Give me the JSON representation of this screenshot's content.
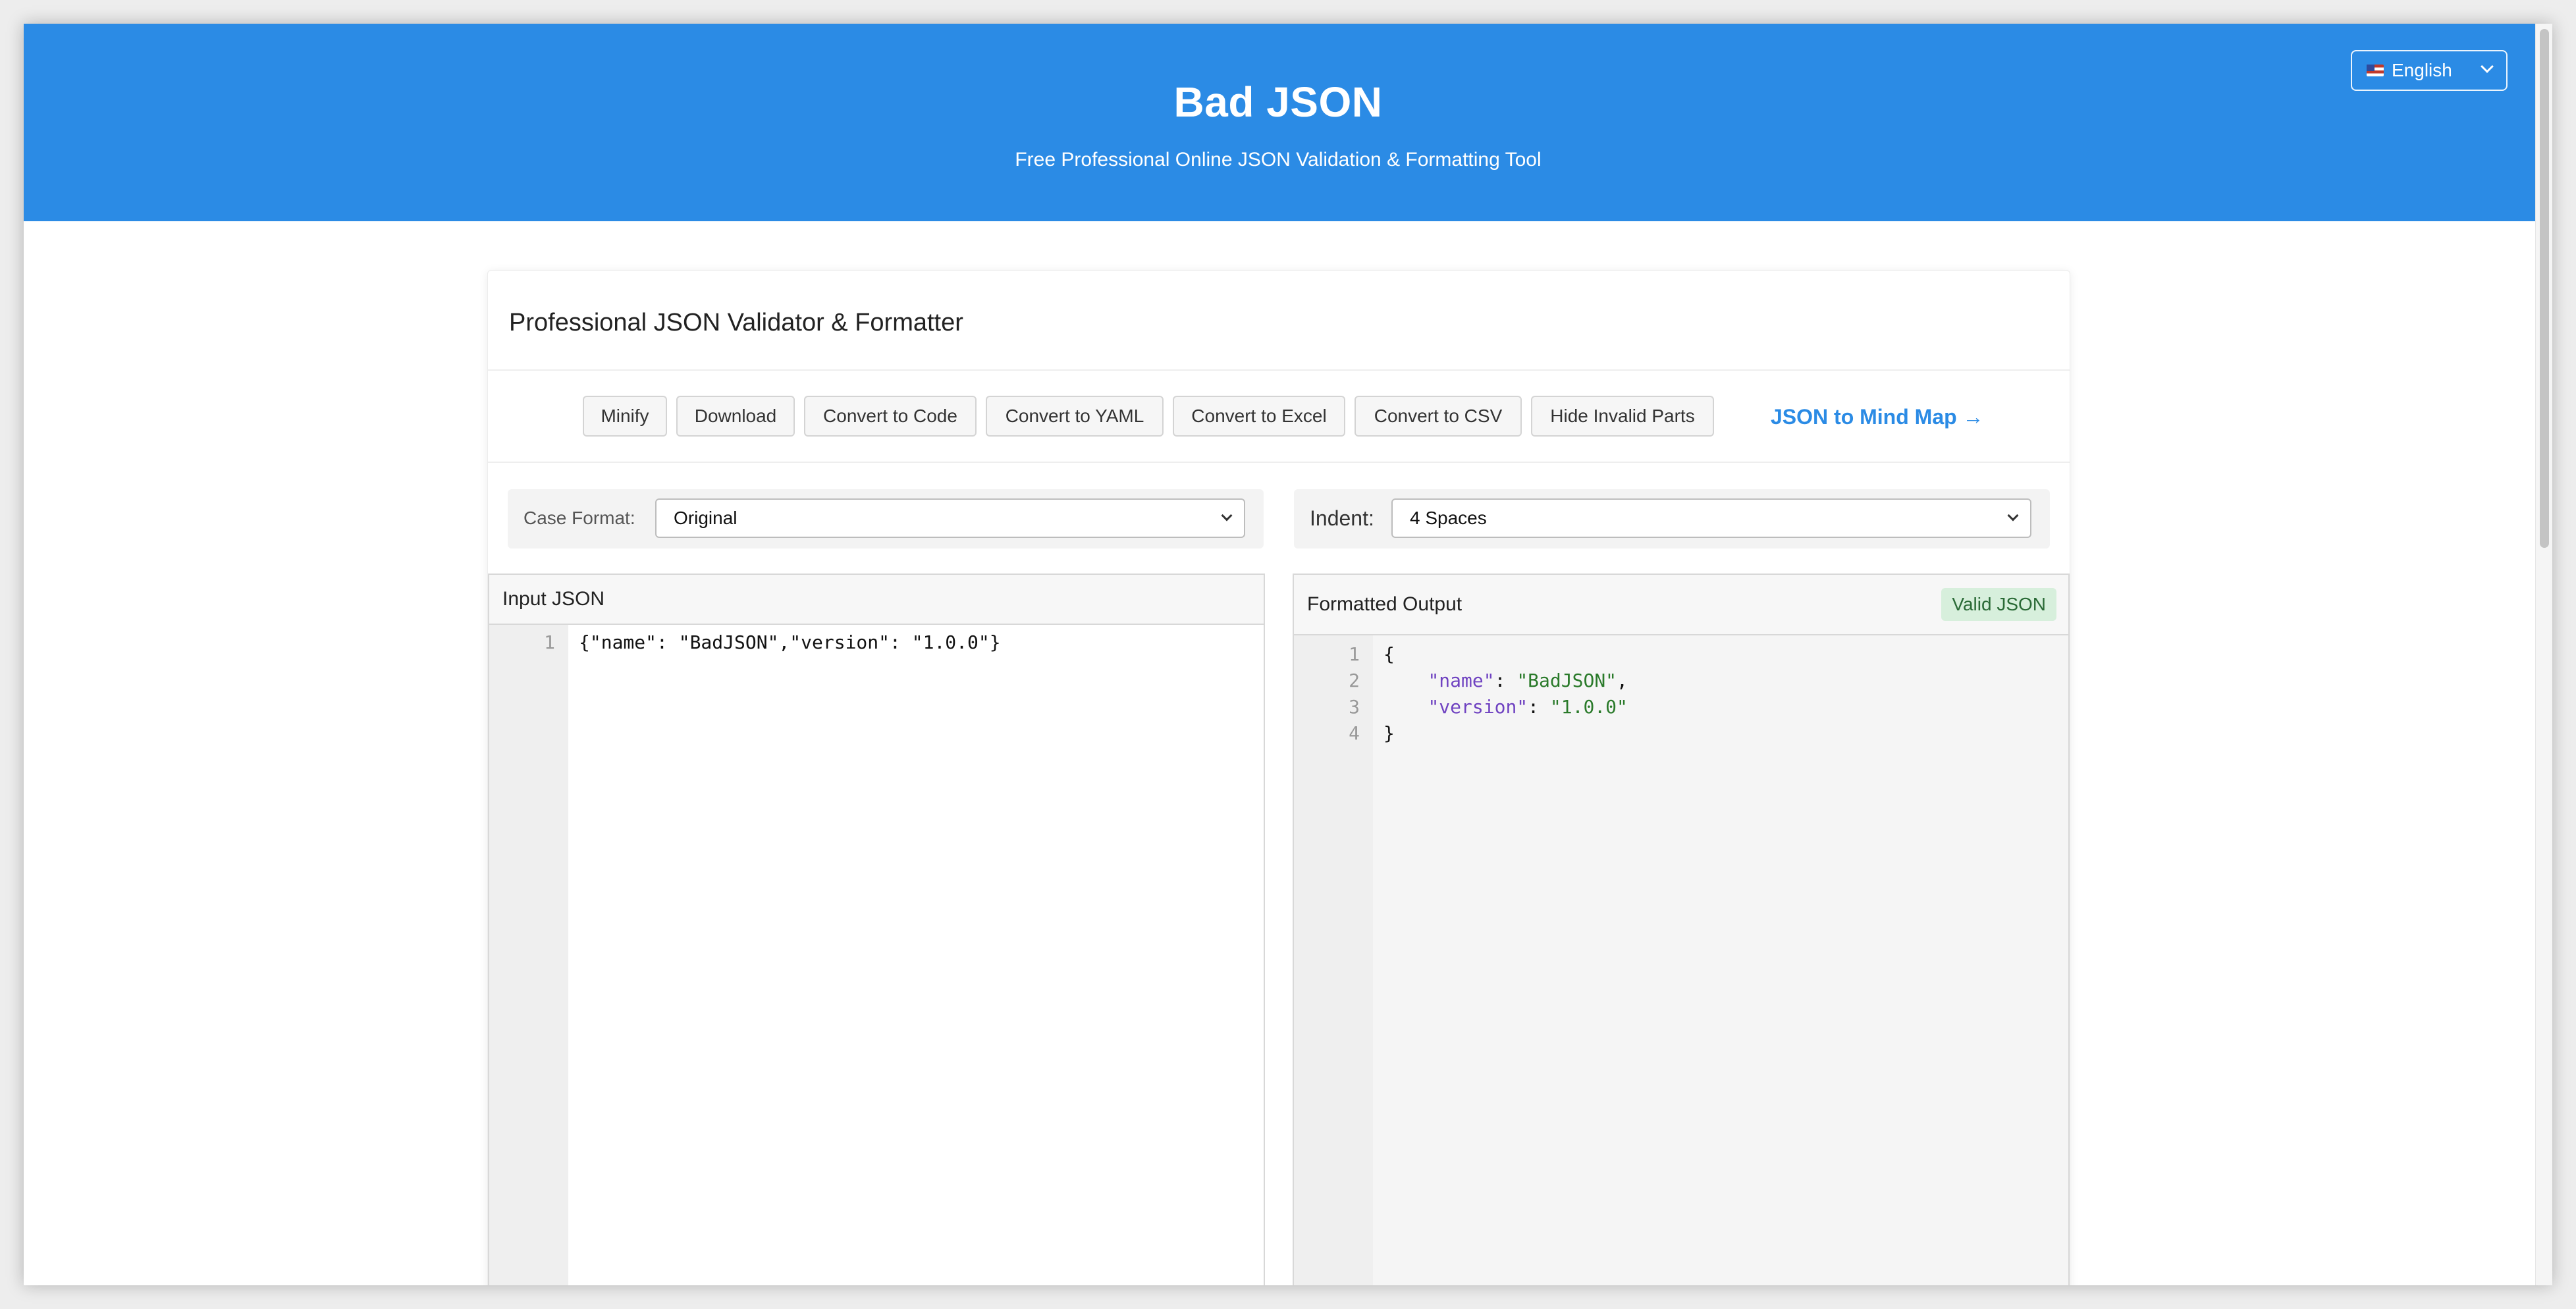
{
  "header": {
    "title": "Bad JSON",
    "subtitle": "Free Professional Online JSON Validation & Formatting Tool",
    "language": "English",
    "flag_icon": "us-flag-icon"
  },
  "card": {
    "title": "Professional JSON Validator & Formatter"
  },
  "toolbar": {
    "buttons": [
      "Minify",
      "Download",
      "Convert to Code",
      "Convert to YAML",
      "Convert to Excel",
      "Convert to CSV",
      "Hide Invalid Parts"
    ],
    "mindmap_link": "JSON to Mind Map →"
  },
  "options": {
    "case_label": "Case Format:",
    "case_value": "Original",
    "indent_label": "Indent:",
    "indent_value": "4 Spaces"
  },
  "input_panel": {
    "title": "Input JSON",
    "line_numbers": [
      "1"
    ],
    "content": "{\"name\": \"BadJSON\",\"version\": \"1.0.0\"}"
  },
  "output_panel": {
    "title": "Formatted Output",
    "status": "Valid JSON",
    "line_numbers": [
      "1",
      "2",
      "3",
      "4"
    ],
    "lines": {
      "open": "{",
      "name_key": "\"name\"",
      "name_val": "\"BadJSON\"",
      "version_key": "\"version\"",
      "version_val": "\"1.0.0\"",
      "close": "}"
    }
  },
  "colors": {
    "header_bg": "#2b8be5",
    "link": "#2b8be5",
    "valid_badge_bg": "#d7efdc",
    "json_key": "#6f42c1",
    "json_string": "#2a7a2a"
  }
}
